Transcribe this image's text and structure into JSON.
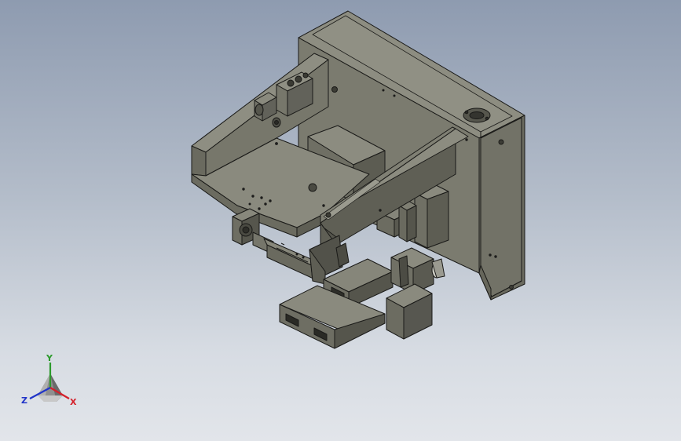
{
  "viewport": {
    "background_top": "#8e9bb0",
    "background_bottom": "#e2e5ea"
  },
  "model": {
    "body_color": "#6e6e64",
    "face_light": "#8a8a7e",
    "face_mid": "#7a7a6e",
    "face_dark": "#4e4e46",
    "edge_color": "#1a1a18"
  },
  "triad": {
    "x_label": "X",
    "y_label": "Y",
    "z_label": "Z",
    "x_color": "#d4202a",
    "y_color": "#2c9a2c",
    "z_color": "#2034c8"
  }
}
